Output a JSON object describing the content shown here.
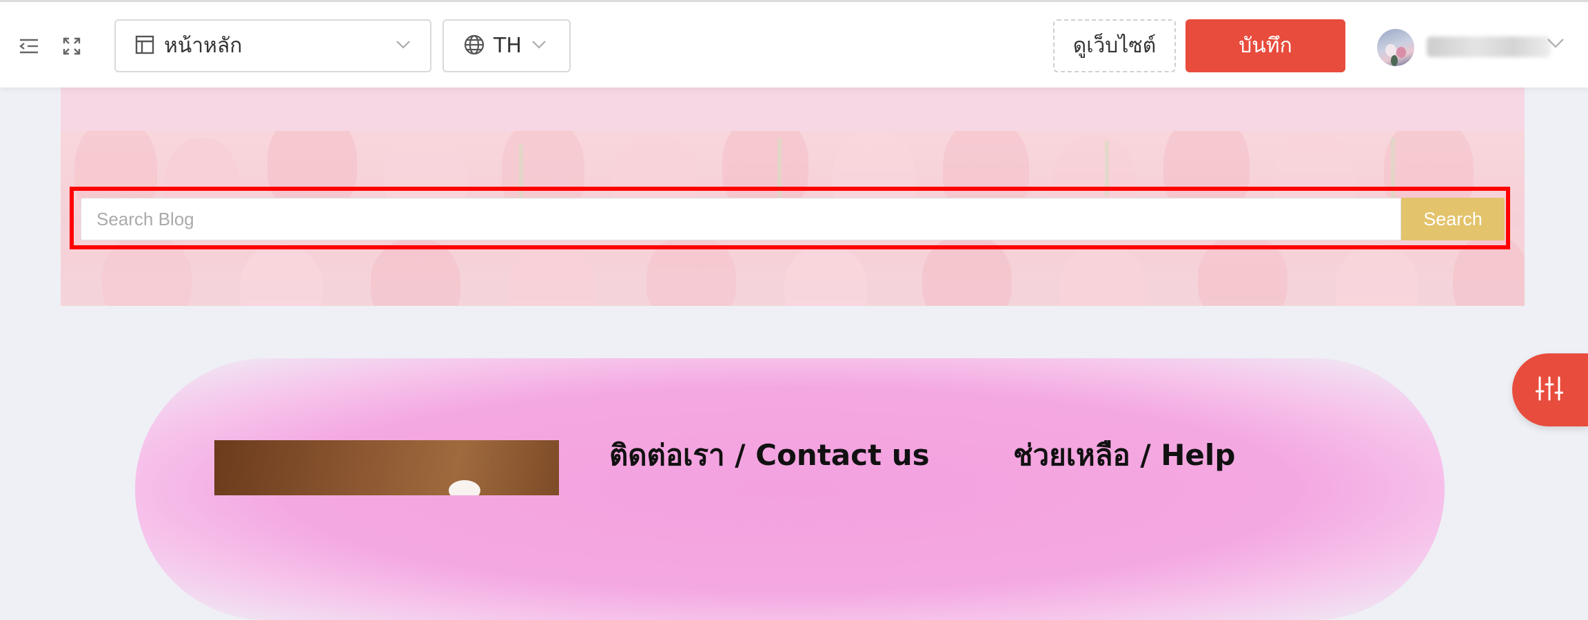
{
  "toolbar": {
    "icons": {
      "collapse": "indent-menu-icon",
      "fullscreen": "fullscreen-icon",
      "page": "layout-icon",
      "language": "globe-icon",
      "chevron": "chevron-down-icon"
    },
    "page_select": {
      "value": "หน้าหลัก"
    },
    "language_select": {
      "value": "TH"
    },
    "view_site_label": "ดูเว็บไซต์",
    "save_label": "บันทึก",
    "user": {
      "avatar": "user-avatar"
    }
  },
  "banner": {
    "search": {
      "placeholder": "Search Blog",
      "button_label": "Search"
    }
  },
  "footer": {
    "contact_heading": "ติดต่อเรา / Contact us",
    "help_heading": "ช่วยเหลือ / Help"
  },
  "settings_fab": {
    "icon": "sliders-icon"
  },
  "colors": {
    "accent": "#e84c3d",
    "search_button": "#e3c36c",
    "highlight_frame": "#ff0000",
    "footer_pink": "#f4a8e1"
  }
}
